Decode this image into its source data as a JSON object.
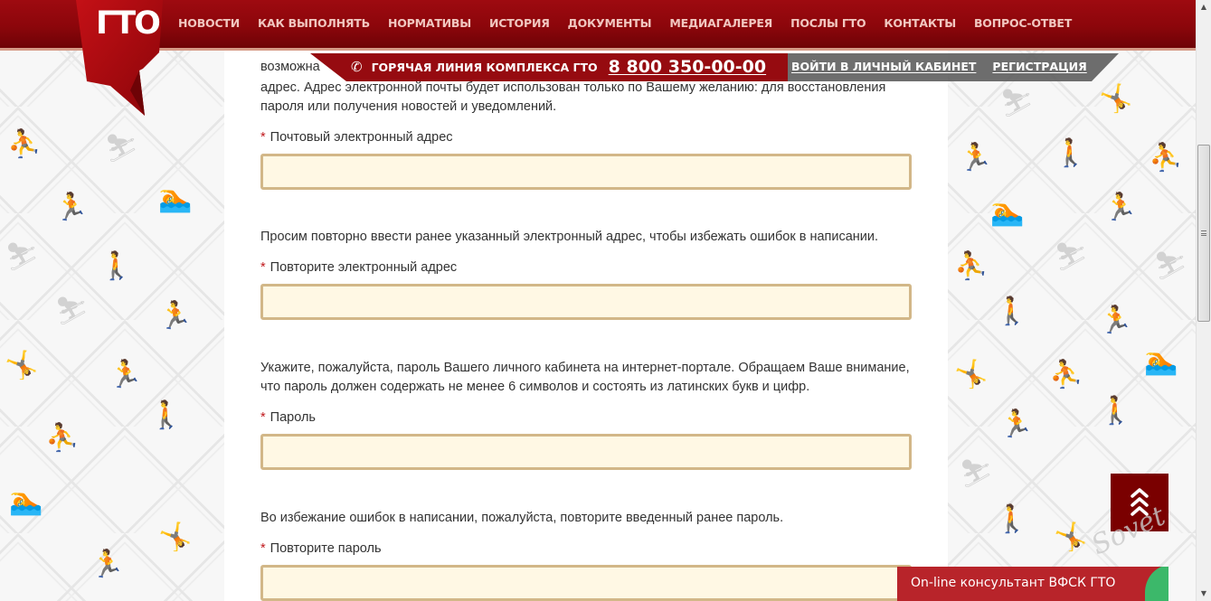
{
  "header": {
    "logo_text": "ГТО",
    "nav": [
      {
        "label": "НОВОСТИ"
      },
      {
        "label": "КАК ВЫПОЛНЯТЬ"
      },
      {
        "label": "НОРМАТИВЫ"
      },
      {
        "label": "ИСТОРИЯ"
      },
      {
        "label": "ДОКУМЕНТЫ"
      },
      {
        "label": "МЕДИАГАЛЕРЕЯ"
      },
      {
        "label": "ПОСЛЫ ГТО"
      },
      {
        "label": "КОНТАКТЫ"
      },
      {
        "label": "ВОПРОС-ОТВЕТ"
      }
    ]
  },
  "hotline": {
    "icon": "phone-icon",
    "label": "ГОРЯЧАЯ ЛИНИЯ КОМПЛЕКСА ГТО",
    "number": "8 800 350-00-00"
  },
  "auth": {
    "login_label": "ВОЙТИ В ЛИЧНЫЙ КАБИНЕТ",
    "register_label": "РЕГИСТРАЦИЯ"
  },
  "form": {
    "intro_partial_line": "возможна",
    "intro_text": "адрес. Адрес электронной почты будет использован только по Вашему желанию: для восстановления пароля или получения новостей и уведомлений.",
    "required_mark": "*",
    "fields": [
      {
        "label": "Почтовый электронный адрес",
        "value": "",
        "type": "email"
      },
      {
        "description": "Просим повторно ввести ранее указанный электронный адрес, чтобы избежать ошибок в написании.",
        "label": "Повторите электронный адрес",
        "value": "",
        "type": "email"
      },
      {
        "description": "Укажите, пожалуйста, пароль Вашего личного кабинета на интернет-портале. Обращаем Ваше внимание, что пароль должен содержать не менее 6 символов и состоять из латинских букв и цифр.",
        "label": "Пароль",
        "value": "",
        "type": "password"
      },
      {
        "description": "Во избежание ошибок в написании, пожалуйста, повторите введенный ранее пароль.",
        "label": "Повторите пароль",
        "value": "",
        "type": "password"
      }
    ]
  },
  "scroll_top": {
    "icon": "chevrons-up-icon"
  },
  "consultant": {
    "label": "On-line консультант ВФСК ГТО"
  },
  "watermark": {
    "text": "Sovet"
  },
  "colors": {
    "brand_red": "#8c060b",
    "input_bg": "#fff8e4",
    "input_border": "#d2b788",
    "required": "#c0181c"
  }
}
